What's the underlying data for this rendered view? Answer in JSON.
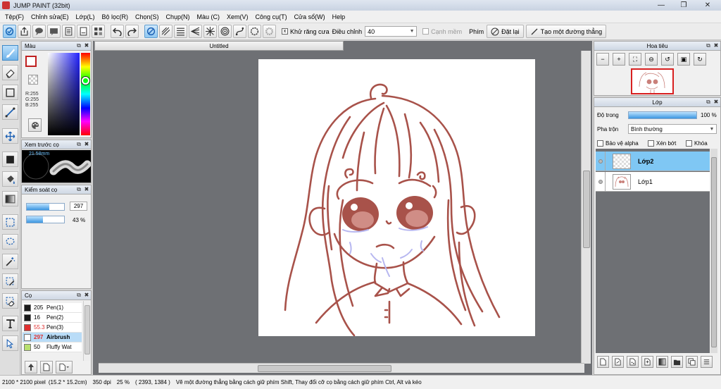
{
  "window": {
    "title": "JUMP PAINT (32bit)",
    "minimize": "—",
    "restore": "❐",
    "close": "✕"
  },
  "menu": [
    "Tệp(F)",
    "Chỉnh sửa(E)",
    "Lớp(L)",
    "Bộ lọc(R)",
    "Chọn(S)",
    "Chụp(N)",
    "Màu (C)",
    "Xem(V)",
    "Công cụ(T)",
    "Cửa sổ(W)",
    "Help"
  ],
  "toolbar": {
    "antialias_label": "Khử răng cưa",
    "adjust_label": "Điều chỉnh",
    "adjust_value": "40",
    "edge_label": "Cạnh mềm",
    "key_label": "Phím",
    "reset_label": "Đặt lại",
    "straight_line_label": "Tạo một đường thẳng"
  },
  "color_panel": {
    "title": "Màu",
    "r": "R:255",
    "g": "G:255",
    "b": "B:255",
    "foreground": "#ffffff",
    "hue_fraction": 0.35
  },
  "brush_preview": {
    "title": "Xem trước cọ",
    "size_text": "21.58mm"
  },
  "brush_control": {
    "title": "Kiểm soát cọ",
    "size_value": "297",
    "size_fraction": 0.6,
    "opacity_value": "43 %",
    "opacity_fraction": 0.43
  },
  "brush_list": {
    "title": "Cọ",
    "items": [
      {
        "value": "205",
        "name": "Pen(1)",
        "color": "#1a1a1a"
      },
      {
        "value": "16",
        "name": "Pen(2)",
        "color": "#1a1a1a"
      },
      {
        "value": "55.3",
        "name": "Pen(3)",
        "color": "#e03030"
      },
      {
        "value": "297",
        "name": "Airbrush",
        "color": "#ffffff"
      },
      {
        "value": "50",
        "name": "Fluffy Wat",
        "color": "#b8e070"
      }
    ]
  },
  "document": {
    "tab_title": "Untitled"
  },
  "navigator": {
    "title": "Hoa tiêu"
  },
  "layers_panel": {
    "title": "Lớp",
    "opacity_label": "Độ trong",
    "opacity_value": "100 %",
    "opacity_fraction": 1.0,
    "blend_label": "Pha trộn",
    "blend_value": "Bình thường",
    "protect_alpha": "Bảo vệ alpha",
    "clip": "Xén bớt",
    "lock": "Khóa",
    "layers": [
      "Lớp2",
      "Lớp1"
    ]
  },
  "status": {
    "size": "2100 * 2100 pixel",
    "physical": "(15.2 * 15.2cm)",
    "dpi": "350 dpi",
    "zoom": "25 %",
    "cursor": "( 2393, 1384 )",
    "hint": "Vẽ một đường thẳng bằng cách giữ phím Shift, Thay đổi cỡ cọ bằng cách giữ phím Ctrl, Alt và kéo"
  },
  "colors": {
    "stroke": "#a8524a",
    "accent": "#3b96e0"
  }
}
